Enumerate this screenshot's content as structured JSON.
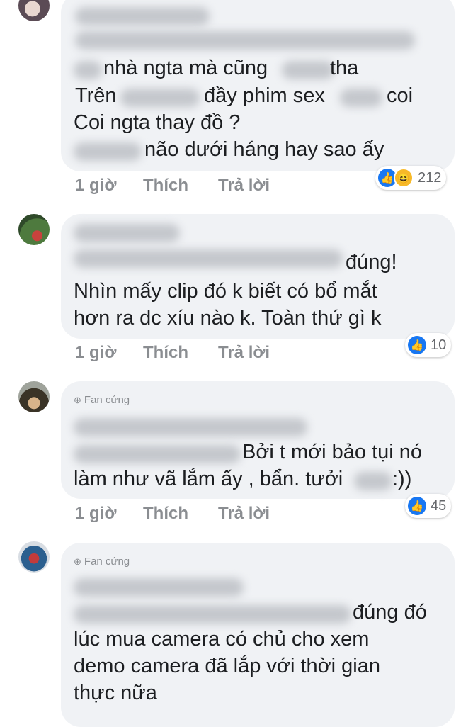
{
  "actions": {
    "time": "1 giờ",
    "like": "Thích",
    "reply": "Trả lời"
  },
  "comments": [
    {
      "lines": [
        "nhà ngta mà cũng",
        "tha",
        "Trên",
        "đầy phim sex",
        "coi",
        "Coi ngta thay đồ ?",
        "não dưới háng hay sao ấy"
      ],
      "reaction_count": "212",
      "reactions": [
        "like-icon",
        "haha-icon"
      ]
    },
    {
      "lines": [
        "đúng!",
        "Nhìn mấy clip đó k biết có bổ mắt",
        "hơn ra dc xíu nào k. Toàn thứ gì k"
      ],
      "reaction_count": "10",
      "reactions": [
        "like-icon"
      ]
    },
    {
      "badge": "Fan cứng",
      "lines": [
        "Bởi t mới bảo tụi nó",
        "làm như vã lắm ấy , bẩn. tưởi",
        ":))"
      ],
      "reaction_count": "45",
      "reactions": [
        "like-icon"
      ]
    },
    {
      "badge": "Fan cứng",
      "lines": [
        "đúng đó",
        "lúc mua camera có chủ cho xem",
        "demo camera đã lắp với thời gian",
        "thực nữa"
      ]
    }
  ],
  "colors": {
    "bubble": "#f0f2f5",
    "like_blue": "#1877f2",
    "meta_gray": "#8a8d91"
  }
}
